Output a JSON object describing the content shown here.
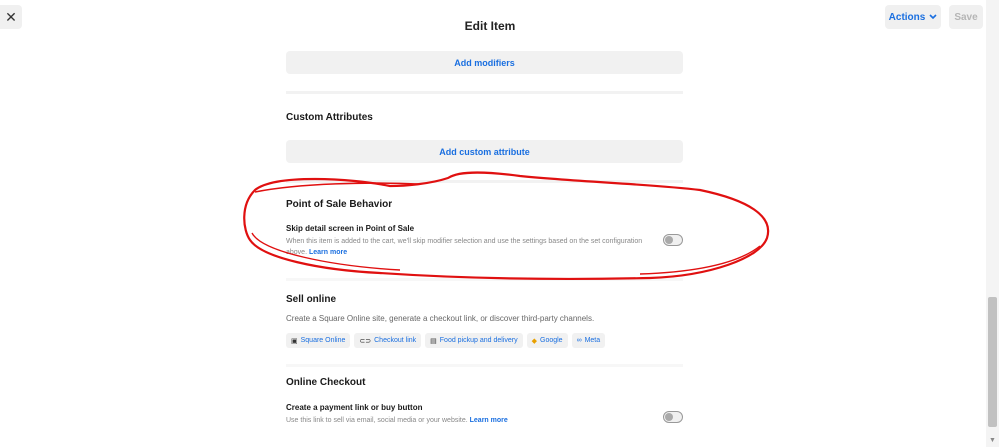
{
  "header": {
    "close_glyph": "✕",
    "title": "Edit Item",
    "actions_label": "Actions",
    "save_label": "Save"
  },
  "modifiers": {
    "button_label": "Add modifiers"
  },
  "custom_attributes": {
    "title": "Custom Attributes",
    "button_label": "Add custom attribute"
  },
  "pos_behavior": {
    "title": "Point of Sale Behavior",
    "setting_label": "Skip detail screen in Point of Sale",
    "description": "When this item is added to the cart, we'll skip modifier selection and use the settings based on the set configuration",
    "description_cont": "above.",
    "link": "Learn more",
    "toggle_on": false
  },
  "sell_online": {
    "title": "Sell online",
    "description": "Create a Square Online site, generate a checkout link, or discover third-party channels.",
    "chips": [
      {
        "icon": "square-online-icon",
        "glyph": "▣",
        "label": "Square Online"
      },
      {
        "icon": "link-icon",
        "glyph": "⊂⊃",
        "label": "Checkout link"
      },
      {
        "icon": "receipt-icon",
        "glyph": "▤",
        "label": "Food pickup and delivery"
      },
      {
        "icon": "google-icon",
        "glyph": "◆",
        "label": "Google"
      },
      {
        "icon": "meta-icon",
        "glyph": "∞",
        "label": "Meta"
      }
    ]
  },
  "online_checkout": {
    "title": "Online Checkout",
    "setting_label": "Create a payment link or buy button",
    "description": "Use this link to sell via email, social media or your website.",
    "link": "Learn more",
    "toggle_on": false
  },
  "colors": {
    "accent": "#1a6fe0",
    "annotation": "#e01010"
  }
}
